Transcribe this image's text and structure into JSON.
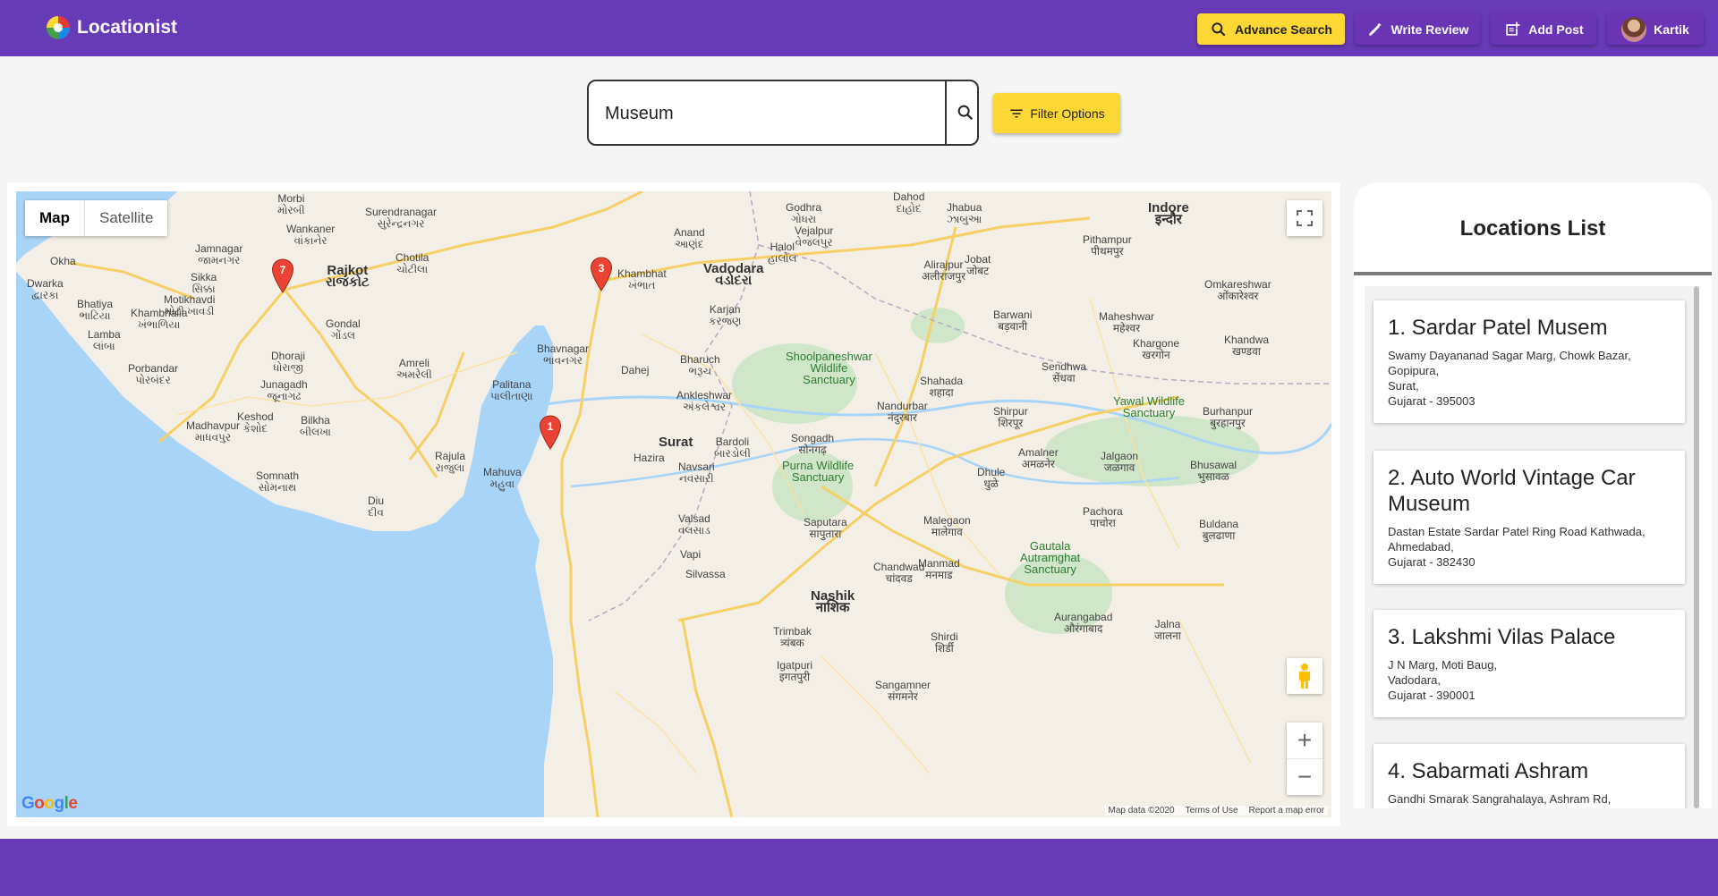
{
  "app": {
    "title": "Locationist"
  },
  "nav": {
    "advance_search": "Advance Search",
    "write_review": "Write Review",
    "add_post": "Add Post",
    "user_name": "Kartik"
  },
  "search": {
    "value": "Museum",
    "filter_label": "Filter Options"
  },
  "map": {
    "type_map": "Map",
    "type_satellite": "Satellite",
    "zoom_in": "+",
    "zoom_out": "−",
    "footer": {
      "data": "Map data ©2020",
      "terms": "Terms of Use",
      "report": "Report a map error"
    },
    "markers": [
      "7",
      "3",
      "1"
    ],
    "labels": {
      "morbi": "Morbi\nમોરબી",
      "surendranagar": "Surendranagar\nસુરેન્દ્રનગર",
      "wankaner": "Wankaner\nવાંકાનેર",
      "jamnagar": "Jamnagar\nજામનગર",
      "okha": "Okha",
      "dwarka": "Dwarka\nદ્વારકા",
      "sikka": "Sikka\nસિક્કા",
      "motikhavdi": "Motikhavdi\nમોટી ખાવડી",
      "bhatiya": "Bhatiya\nભાટિયા",
      "khambhalia": "Khambhalia\nખંભાળિયા",
      "lamba": "Lamba\nલાંબા",
      "rajkot": "Rajkot\nરાજકોટ",
      "chotila": "Chotila\nચોટીલા",
      "gondal": "Gondal\nગોંડલ",
      "dhoraji": "Dhoraji\nધોરાજી",
      "porbandar": "Porbandar\nપોરબંદર",
      "junagadh": "Junagadh\nજૂનાગઢ",
      "amreli": "Amreli\nઅમરેલી",
      "keshod": "Keshod\nકેશોદ",
      "madhavpur": "Madhavpur\nમાધવપુર",
      "bilkha": "Bilkha\nબીલખા",
      "palitana": "Palitana\nપાલીતાણા",
      "bhavnagar": "Bhavnagar\nભાવનગર",
      "rajula": "Rajula\nરાજુલા",
      "mahuva": "Mahuva\nમહુવા",
      "somnath": "Somnath\nસોમનાથ",
      "diu": "Diu\nદીવ",
      "anand": "Anand\nઆણંદ",
      "godhra": "Godhra\nગોધરા",
      "dahod": "Dahod\nદાહોદ",
      "jhabua": "Jhabua\nઝાબુઆ",
      "vejalpur": "Vejalpur\nવેજલપુર",
      "halol": "Halol\nહાલોલ",
      "khambhat": "Khambhat\nખંભાત",
      "vadodara": "Vadodara\nવડોદરા",
      "karjan": "Karjan\nકરજણ",
      "bharuch": "Bharuch\nભરૂચ",
      "ankleshwar": "Ankleshwar\nઅંકલેશ્વર",
      "dahej": "Dahej",
      "surat": "Surat",
      "hazira": "Hazira",
      "bardoli": "Bardoli\nબારડોલી",
      "navsari": "Navsari\nનવસારી",
      "valsad": "Valsad\nવલસાડ",
      "vapi": "Vapi",
      "silvassa": "Silvassa",
      "nashik": "Nashik\nनाशिक",
      "indore": "Indore\nइन्दौर",
      "pithampur": "Pithampur\nपीथमपुर",
      "shoolpaneshwar": "Shoolpaneshwar\nWildlife\nSanctuary",
      "purna": "Purna Wildlife\nSanctuary",
      "yawal": "Yawal Wildlife\nSanctuary",
      "gautala": "Gautala\nAutramghat\nSanctuary",
      "nandurbar": "Nandurbar\nनंदुरबार",
      "shahada": "Shahada\nशहादा",
      "shirpur": "Shirpur\nशिरपूर",
      "dhule": "Dhule\nधुळे",
      "jalgaon": "Jalgaon\nजळगाव",
      "amalner": "Amalner\nअमळनेर",
      "bhusawal": "Bhusawal\nभुसावळ",
      "burhanpur": "Burhanpur\nबुरहानपुर",
      "khandwa": "Khandwa\nखण्डवा",
      "malegaon": "Malegaon\nमालेगाव",
      "manmad": "Manmad\nमनमाड",
      "aurangabad": "Aurangabad\nऔरंगाबाद",
      "jalna": "Jalna\nजालना",
      "buldana": "Buldana\nबुलढाणा",
      "sangamner": "Sangamner\nसंगमनेर",
      "shirdi": "Shirdi\nशिर्डी",
      "igatpuri": "Igatpuri\nइगतपुरी",
      "trimbak": "Trimbak\nत्र्यंबक",
      "saputara": "Saputara\nसापुतारा",
      "barwani": "Barwani\nबड़वानी",
      "maheshwar": "Maheshwar\nमहेश्वर",
      "khargone": "Khargone\nखरगोन",
      "sendhwa": "Sendhwa\nसेंधवा",
      "omkareshwar": "Omkareshwar\nओंकारेश्वर",
      "pachora": "Pachora\nपाचोरा",
      "chandwad": "Chandwad\nचांदवड",
      "songadh": "Songadh\nसोनगढ़",
      "alirajpur": "Alirajpur\nअलीराजपुर",
      "jobat": "Jobat\nजोबट"
    }
  },
  "locations": {
    "title": "Locations List",
    "items": [
      {
        "title": "1. Sardar Patel Musem",
        "lines": [
          "Swamy Dayananad Sagar Marg, Chowk Bazar,",
          "Gopipura,",
          "Surat,",
          "Gujarat - 395003"
        ]
      },
      {
        "title": "2. Auto World Vintage Car Museum",
        "lines": [
          "Dastan Estate Sardar Patel Ring Road Kathwada,",
          "Ahmedabad,",
          "Gujarat - 382430"
        ]
      },
      {
        "title": "3. Lakshmi Vilas Palace",
        "lines": [
          "J N Marg, Moti Baug,",
          "Vadodara,",
          "Gujarat - 390001"
        ]
      },
      {
        "title": "4. Sabarmati Ashram",
        "lines": [
          "Gandhi Smarak Sangrahalaya, Ashram Rd,"
        ]
      }
    ]
  },
  "colors": {
    "primary": "#673ab7",
    "accent": "#fdd835",
    "water": "#a8d4f7",
    "land": "#f3efe7",
    "park": "#cfe6c8"
  }
}
